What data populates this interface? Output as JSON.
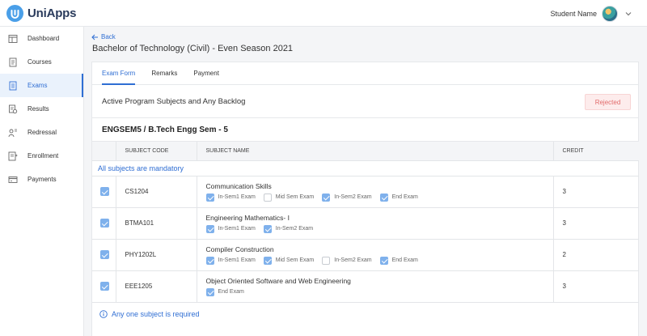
{
  "app": {
    "name": "UniApps"
  },
  "user": {
    "name": "Student Name"
  },
  "sidebar": {
    "items": [
      {
        "label": "Dashboard",
        "icon": "dashboard-icon",
        "active": false
      },
      {
        "label": "Courses",
        "icon": "courses-icon",
        "active": false
      },
      {
        "label": "Exams",
        "icon": "exams-icon",
        "active": true
      },
      {
        "label": "Results",
        "icon": "results-icon",
        "active": false
      },
      {
        "label": "Redressal",
        "icon": "redressal-icon",
        "active": false
      },
      {
        "label": "Enrollment",
        "icon": "enrollment-icon",
        "active": false
      },
      {
        "label": "Payments",
        "icon": "payments-icon",
        "active": false
      }
    ]
  },
  "header": {
    "back_label": "Back",
    "title": "Bachelor of Technology (Civil) - Even Season 2021"
  },
  "tabs": [
    {
      "label": "Exam Form",
      "active": true
    },
    {
      "label": "Remarks",
      "active": false
    },
    {
      "label": "Payment",
      "active": false
    }
  ],
  "section": {
    "title": "Active Program Subjects and Any Backlog",
    "status": "Rejected"
  },
  "program": {
    "title": "ENGSEM5 / B.Tech Engg Sem - 5"
  },
  "table": {
    "columns": [
      "SUBJECT CODE",
      "SUBJECT NAME",
      "CREDIT"
    ],
    "group_label": "All subjects are mandatory",
    "rows": [
      {
        "code": "CS1204",
        "name": "Communication Skills",
        "credit": "3",
        "checked": true,
        "exams": [
          {
            "label": "In-Sem1 Exam",
            "checked": true
          },
          {
            "label": "Mid Sem Exam",
            "checked": false
          },
          {
            "label": "In-Sem2 Exam",
            "checked": true
          },
          {
            "label": "End Exam",
            "checked": true
          }
        ]
      },
      {
        "code": "BTMA101",
        "name": "Engineering Mathematics- I",
        "credit": "3",
        "checked": true,
        "exams": [
          {
            "label": "In-Sem1 Exam",
            "checked": true
          },
          {
            "label": "In-Sem2 Exam",
            "checked": true
          }
        ]
      },
      {
        "code": "PHY1202L",
        "name": "Compiler Construction",
        "credit": "2",
        "checked": true,
        "exams": [
          {
            "label": "In-Sem1 Exam",
            "checked": true
          },
          {
            "label": "Mid Sem Exam",
            "checked": true
          },
          {
            "label": "In-Sem2 Exam",
            "checked": false
          },
          {
            "label": "End Exam",
            "checked": true
          }
        ]
      },
      {
        "code": "EEE1205",
        "name": "Object Oriented Software and Web Engineering",
        "credit": "3",
        "checked": true,
        "exams": [
          {
            "label": "End Exam",
            "checked": true
          }
        ]
      }
    ]
  },
  "note": {
    "text": "Any one subject is required"
  },
  "colors": {
    "accent": "#2f6ed3",
    "checkbox": "#7fb1ec",
    "rejected_bg": "#fdecec",
    "rejected_text": "#e26b6b"
  }
}
